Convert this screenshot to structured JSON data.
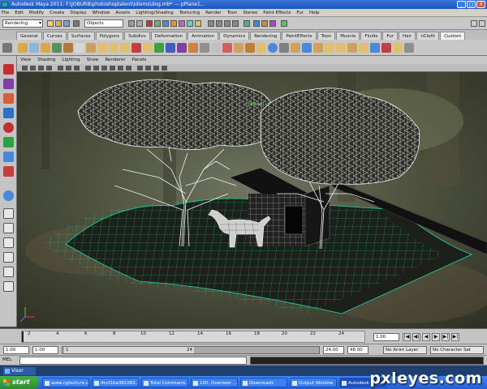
{
  "window": {
    "title": "Autodesk Maya 2011: F:\\JOBURB\\photoshoptalent\\idioms\\dog.mb*   ---   pPlane1...",
    "buttons": [
      "_",
      "□",
      "X"
    ]
  },
  "menubar": [
    "File",
    "Edit",
    "Modify",
    "Create",
    "Display",
    "Window",
    "Assets",
    "Lighting/Shading",
    "Texturing",
    "Render",
    "Toon",
    "Stereo",
    "Paint Effects",
    "Fur",
    "Help"
  ],
  "statusline": {
    "mode": "Rendering",
    "object_field": "Objects"
  },
  "shelf_tabs": {
    "items": [
      "General",
      "Curves",
      "Surfaces",
      "Polygons",
      "Subdivs",
      "Deformation",
      "Animation",
      "Dynamics",
      "Rendering",
      "PaintEffects",
      "Toon",
      "Muscle",
      "Fluids",
      "Fur",
      "Hair",
      "nCloth",
      "Custom"
    ],
    "active": "Custom"
  },
  "panel_menu": [
    "View",
    "Shading",
    "Lighting",
    "Show",
    "Renderer",
    "Panels"
  ],
  "viewport": {
    "object_label": "pPlane1"
  },
  "timeline": {
    "ticks": [
      "2",
      "4",
      "6",
      "8",
      "10",
      "12",
      "14",
      "16",
      "18",
      "20",
      "22",
      "24"
    ],
    "current_frame": "1.00",
    "controls": [
      "|◀",
      "◀|",
      "◀",
      "▶",
      "▶|",
      "▶|"
    ]
  },
  "range": {
    "start": "1.00",
    "anim_start": "1.00",
    "thumb_start": "1",
    "thumb_end": "24",
    "end": "24.00",
    "anim_end": "48.00",
    "anim_layer": "No Anim Layer",
    "character_set": "No Character Set"
  },
  "cmdline": {
    "label": "MEL"
  },
  "helpline": {
    "window_label": "Visor"
  },
  "taskbar": {
    "start": "start",
    "tasks": [
      "www.cgtecture.com...",
      "4ccf1ba381082...",
      "Total Command...",
      "100. Overseer ...",
      "Downloads",
      "Output Window",
      "Autodesk Maya ..."
    ],
    "active_task": "Autodesk Maya ..."
  },
  "watermark": "pxleyes.com"
}
